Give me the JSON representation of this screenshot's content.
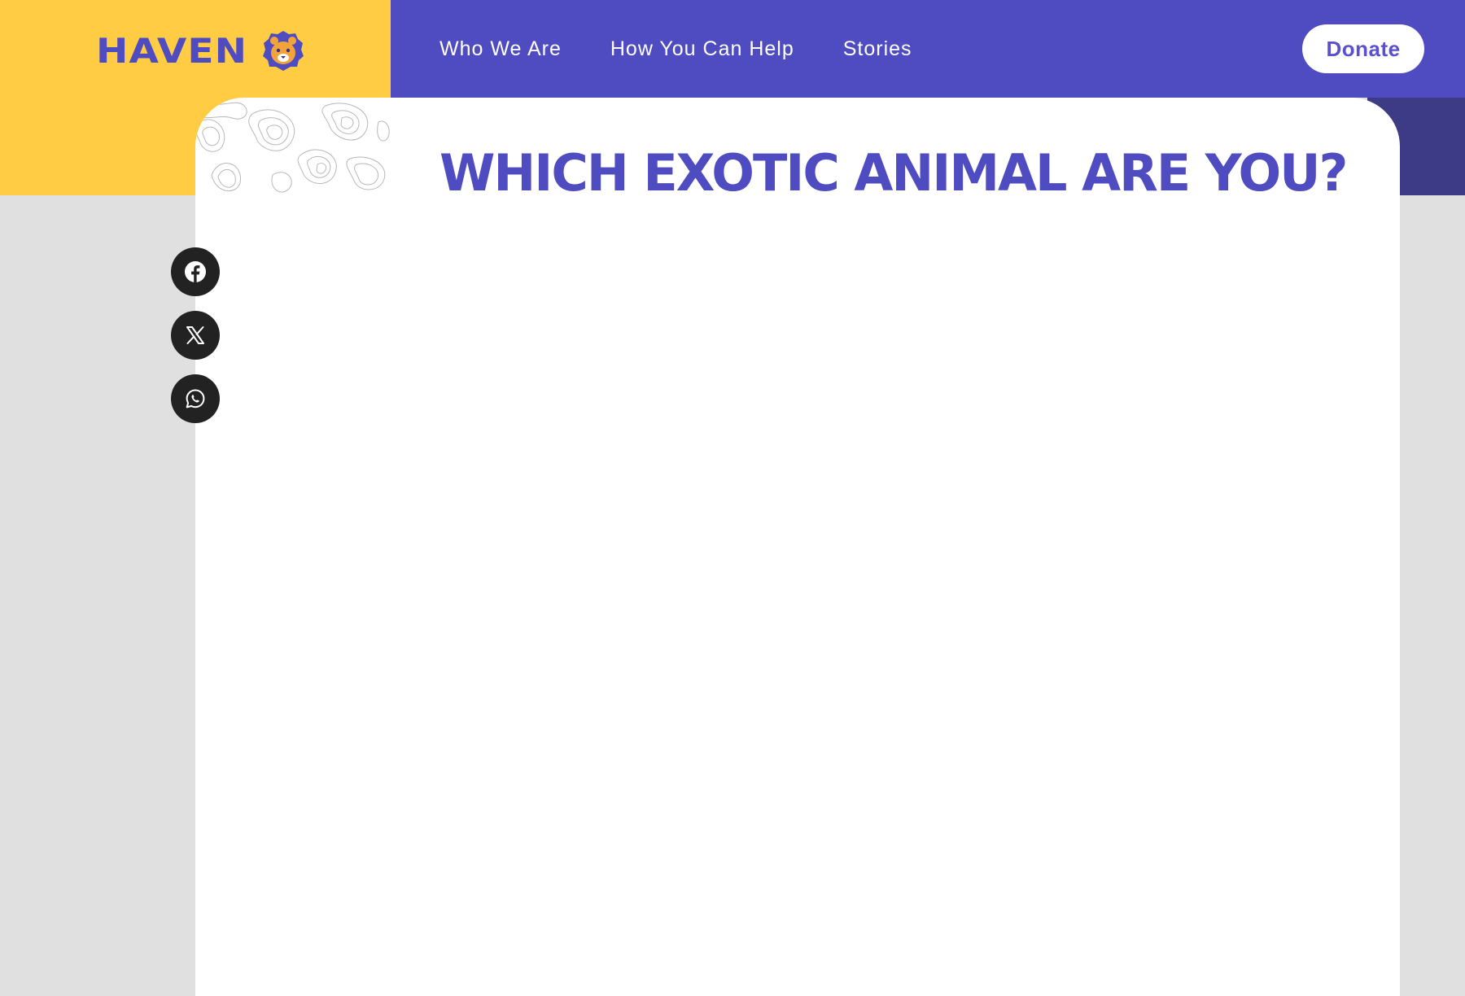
{
  "brand": {
    "name": "HAVEN",
    "logo_icon": "lion-face-icon",
    "colors": {
      "yellow": "#ffcc44",
      "purple": "#4f4bc0",
      "dark_purple": "#3d3a86"
    }
  },
  "nav": {
    "items": [
      {
        "label": "Who We Are"
      },
      {
        "label": "How You Can Help"
      },
      {
        "label": "Stories"
      }
    ],
    "donate_label": "Donate"
  },
  "page": {
    "title": "WHICH EXOTIC ANIMAL ARE YOU?"
  },
  "share": {
    "icons": [
      "facebook-icon",
      "x-icon",
      "whatsapp-icon"
    ]
  }
}
